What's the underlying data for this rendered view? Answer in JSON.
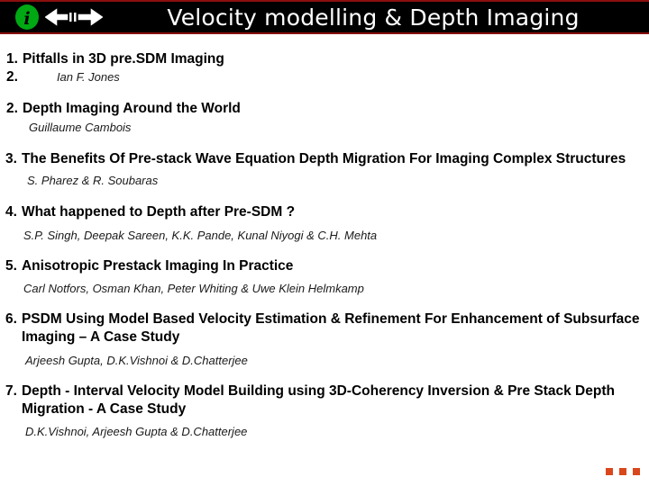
{
  "header": {
    "title": "Velocity modelling  & Depth Imaging",
    "info_icon": "info-circle-icon",
    "nav_icon": "left-right-arrow-icon",
    "background_color": "#000000",
    "border_color": "#8a0f0f",
    "title_color": "#ffffff",
    "info_icon_color": "#00a814"
  },
  "list": {
    "items": [
      {
        "number": "1.",
        "title": "Pitfalls in 3D pre.SDM Imaging",
        "sub_number": "2.",
        "authors": "Ian F. Jones"
      },
      {
        "number": "2.",
        "title": "Depth Imaging Around the World",
        "authors": "Guillaume Cambois"
      },
      {
        "number": "3.",
        "title": "The Benefits Of Pre-stack Wave Equation Depth  Migration For Imaging Complex Structures",
        "authors": "S. Pharez  & R. Soubaras"
      },
      {
        "number": "4.",
        "title": "What happened to Depth after Pre-SDM ?",
        "authors": "S.P. Singh, Deepak Sareen, K.K. Pande, Kunal Niyogi & C.H. Mehta"
      },
      {
        "number": "5.",
        "title": "Anisotropic Prestack Imaging In Practice",
        "authors": "Carl Notfors, Osman Khan, Peter Whiting & Uwe Klein Helmkamp"
      },
      {
        "number": "6.",
        "title": "PSDM Using Model Based Velocity Estimation & Refinement For Enhancement of Subsurface Imaging – A Case Study",
        "authors": "Arjeesh Gupta, D.K.Vishnoi & D.Chatterjee"
      },
      {
        "number": "7.",
        "title": "Depth - Interval Velocity Model Building using 3D-Coherency Inversion  & Pre Stack Depth Migration - A Case Study",
        "authors": "D.K.Vishnoi,  Arjeesh Gupta & D.Chatterjee"
      }
    ]
  },
  "footer": {
    "ellipsis_icon": "ellipsis-dots-icon",
    "ellipsis_color": "#d9481c"
  }
}
